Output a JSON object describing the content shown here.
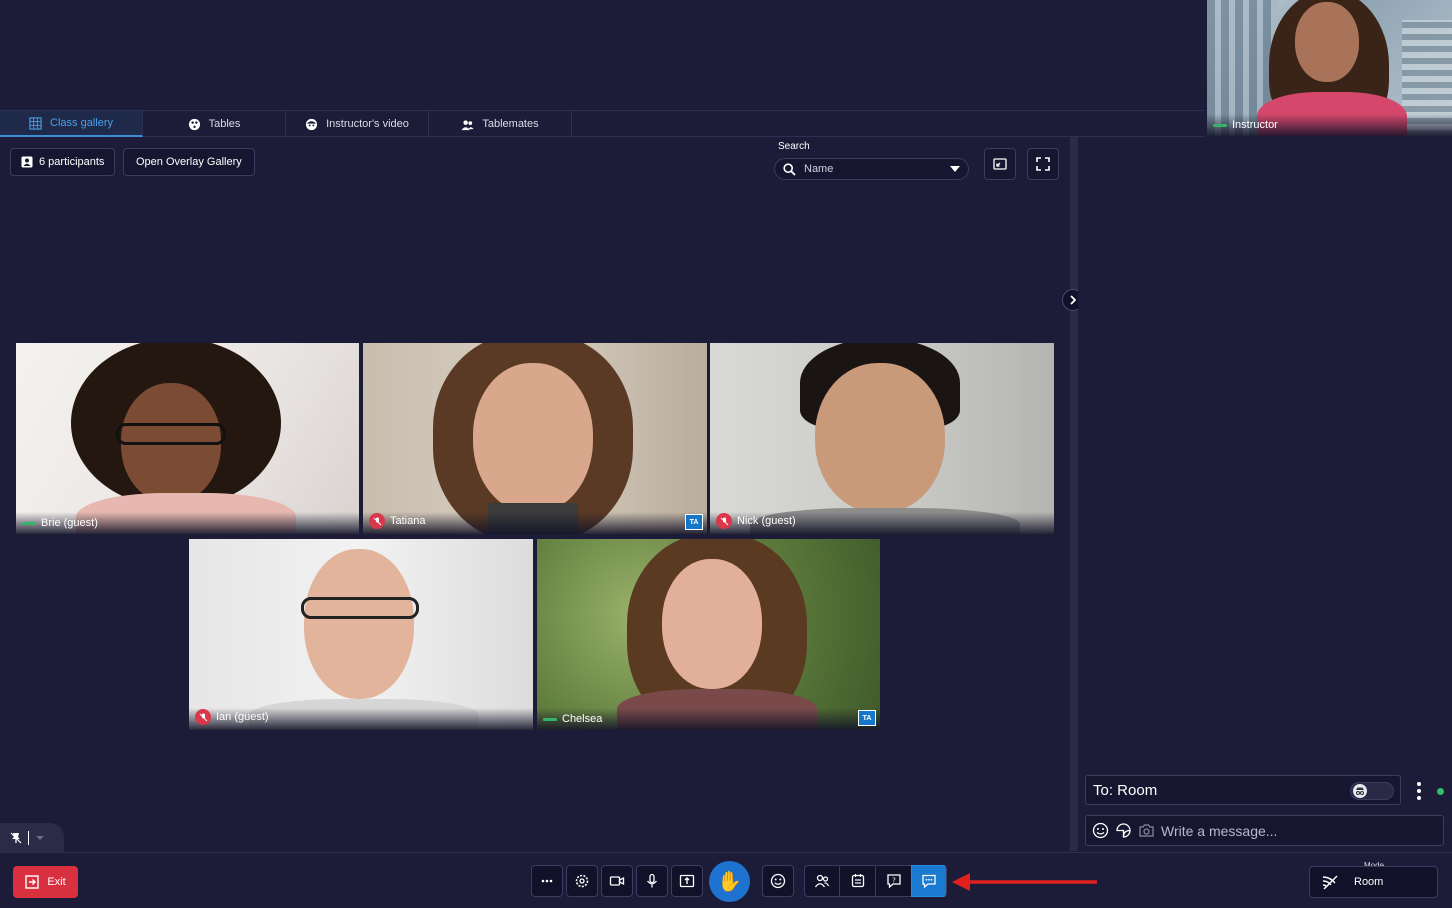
{
  "instructor": {
    "name": "Instructor"
  },
  "tabs": [
    {
      "label": "Class gallery",
      "icon": "grid-icon",
      "active": true
    },
    {
      "label": "Tables",
      "icon": "table-icon",
      "active": false
    },
    {
      "label": "Instructor's video",
      "icon": "face-icon",
      "active": false
    },
    {
      "label": "Tablemates",
      "icon": "people-icon",
      "active": false
    }
  ],
  "gallery": {
    "participants_label": "6 participants",
    "overlay_button": "Open Overlay Gallery",
    "search_label": "Search",
    "search_placeholder": "Name"
  },
  "participants": [
    {
      "name": "Brie (guest)",
      "muted": false,
      "ta": false
    },
    {
      "name": "Tatiana",
      "muted": true,
      "ta": true
    },
    {
      "name": "Nick (guest)",
      "muted": true,
      "ta": false
    },
    {
      "name": "Ian (guest)",
      "muted": true,
      "ta": false
    },
    {
      "name": "Chelsea",
      "muted": false,
      "ta": true
    }
  ],
  "ta_badge": "TA",
  "chat": {
    "to_label": "To: Room",
    "message_placeholder": "Write a message..."
  },
  "toolbar": {
    "exit_label": "Exit",
    "hand_emoji": "✋",
    "mode_label": "Mode",
    "mode_value": "Room"
  },
  "colors": {
    "background": "#1c1c38",
    "accent": "#1a7ad0",
    "exit": "#d8303e",
    "muted": "#d8384a",
    "online": "#2fbf6a"
  }
}
